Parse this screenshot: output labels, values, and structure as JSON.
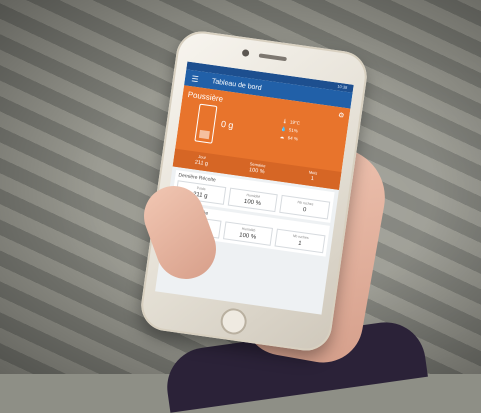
{
  "app": {
    "title": "Tableau de bord"
  },
  "statusbar": {
    "time": "10:38"
  },
  "hive": {
    "name": "Poussière",
    "weight": "0 g",
    "sensors": [
      "19°C",
      "51%",
      "64 %"
    ],
    "stats": [
      {
        "label": "Jour",
        "value": "211 g"
      },
      {
        "label": "Semaine",
        "value": "100 %"
      },
      {
        "label": "Mois",
        "value": "1"
      }
    ]
  },
  "sections": [
    {
      "title": "Dernière Récolte",
      "cards": [
        {
          "label": "Poids",
          "value": "211 g"
        },
        {
          "label": "Humidité",
          "value": "100 %"
        },
        {
          "label": "Nb ruches",
          "value": "0"
        }
      ]
    },
    {
      "title": "Dernière Pesée",
      "cards": [
        {
          "label": "Poids",
          "value": "100 g"
        },
        {
          "label": "Humidité",
          "value": "100 %"
        },
        {
          "label": "Nb ruches",
          "value": "1"
        }
      ]
    }
  ],
  "colors": {
    "appbar": "#2160a8",
    "accent": "#e8742c"
  }
}
